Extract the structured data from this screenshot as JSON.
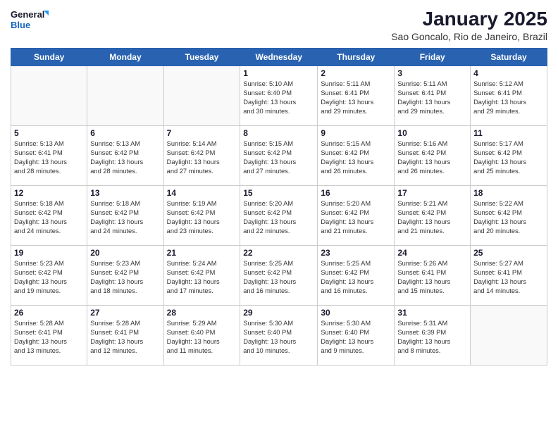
{
  "logo": {
    "line1": "General",
    "line2": "Blue"
  },
  "title": "January 2025",
  "subtitle": "Sao Goncalo, Rio de Janeiro, Brazil",
  "days_header": [
    "Sunday",
    "Monday",
    "Tuesday",
    "Wednesday",
    "Thursday",
    "Friday",
    "Saturday"
  ],
  "weeks": [
    [
      {
        "num": "",
        "info": ""
      },
      {
        "num": "",
        "info": ""
      },
      {
        "num": "",
        "info": ""
      },
      {
        "num": "1",
        "info": "Sunrise: 5:10 AM\nSunset: 6:40 PM\nDaylight: 13 hours\nand 30 minutes."
      },
      {
        "num": "2",
        "info": "Sunrise: 5:11 AM\nSunset: 6:41 PM\nDaylight: 13 hours\nand 29 minutes."
      },
      {
        "num": "3",
        "info": "Sunrise: 5:11 AM\nSunset: 6:41 PM\nDaylight: 13 hours\nand 29 minutes."
      },
      {
        "num": "4",
        "info": "Sunrise: 5:12 AM\nSunset: 6:41 PM\nDaylight: 13 hours\nand 29 minutes."
      }
    ],
    [
      {
        "num": "5",
        "info": "Sunrise: 5:13 AM\nSunset: 6:41 PM\nDaylight: 13 hours\nand 28 minutes."
      },
      {
        "num": "6",
        "info": "Sunrise: 5:13 AM\nSunset: 6:42 PM\nDaylight: 13 hours\nand 28 minutes."
      },
      {
        "num": "7",
        "info": "Sunrise: 5:14 AM\nSunset: 6:42 PM\nDaylight: 13 hours\nand 27 minutes."
      },
      {
        "num": "8",
        "info": "Sunrise: 5:15 AM\nSunset: 6:42 PM\nDaylight: 13 hours\nand 27 minutes."
      },
      {
        "num": "9",
        "info": "Sunrise: 5:15 AM\nSunset: 6:42 PM\nDaylight: 13 hours\nand 26 minutes."
      },
      {
        "num": "10",
        "info": "Sunrise: 5:16 AM\nSunset: 6:42 PM\nDaylight: 13 hours\nand 26 minutes."
      },
      {
        "num": "11",
        "info": "Sunrise: 5:17 AM\nSunset: 6:42 PM\nDaylight: 13 hours\nand 25 minutes."
      }
    ],
    [
      {
        "num": "12",
        "info": "Sunrise: 5:18 AM\nSunset: 6:42 PM\nDaylight: 13 hours\nand 24 minutes."
      },
      {
        "num": "13",
        "info": "Sunrise: 5:18 AM\nSunset: 6:42 PM\nDaylight: 13 hours\nand 24 minutes."
      },
      {
        "num": "14",
        "info": "Sunrise: 5:19 AM\nSunset: 6:42 PM\nDaylight: 13 hours\nand 23 minutes."
      },
      {
        "num": "15",
        "info": "Sunrise: 5:20 AM\nSunset: 6:42 PM\nDaylight: 13 hours\nand 22 minutes."
      },
      {
        "num": "16",
        "info": "Sunrise: 5:20 AM\nSunset: 6:42 PM\nDaylight: 13 hours\nand 21 minutes."
      },
      {
        "num": "17",
        "info": "Sunrise: 5:21 AM\nSunset: 6:42 PM\nDaylight: 13 hours\nand 21 minutes."
      },
      {
        "num": "18",
        "info": "Sunrise: 5:22 AM\nSunset: 6:42 PM\nDaylight: 13 hours\nand 20 minutes."
      }
    ],
    [
      {
        "num": "19",
        "info": "Sunrise: 5:23 AM\nSunset: 6:42 PM\nDaylight: 13 hours\nand 19 minutes."
      },
      {
        "num": "20",
        "info": "Sunrise: 5:23 AM\nSunset: 6:42 PM\nDaylight: 13 hours\nand 18 minutes."
      },
      {
        "num": "21",
        "info": "Sunrise: 5:24 AM\nSunset: 6:42 PM\nDaylight: 13 hours\nand 17 minutes."
      },
      {
        "num": "22",
        "info": "Sunrise: 5:25 AM\nSunset: 6:42 PM\nDaylight: 13 hours\nand 16 minutes."
      },
      {
        "num": "23",
        "info": "Sunrise: 5:25 AM\nSunset: 6:42 PM\nDaylight: 13 hours\nand 16 minutes."
      },
      {
        "num": "24",
        "info": "Sunrise: 5:26 AM\nSunset: 6:41 PM\nDaylight: 13 hours\nand 15 minutes."
      },
      {
        "num": "25",
        "info": "Sunrise: 5:27 AM\nSunset: 6:41 PM\nDaylight: 13 hours\nand 14 minutes."
      }
    ],
    [
      {
        "num": "26",
        "info": "Sunrise: 5:28 AM\nSunset: 6:41 PM\nDaylight: 13 hours\nand 13 minutes."
      },
      {
        "num": "27",
        "info": "Sunrise: 5:28 AM\nSunset: 6:41 PM\nDaylight: 13 hours\nand 12 minutes."
      },
      {
        "num": "28",
        "info": "Sunrise: 5:29 AM\nSunset: 6:40 PM\nDaylight: 13 hours\nand 11 minutes."
      },
      {
        "num": "29",
        "info": "Sunrise: 5:30 AM\nSunset: 6:40 PM\nDaylight: 13 hours\nand 10 minutes."
      },
      {
        "num": "30",
        "info": "Sunrise: 5:30 AM\nSunset: 6:40 PM\nDaylight: 13 hours\nand 9 minutes."
      },
      {
        "num": "31",
        "info": "Sunrise: 5:31 AM\nSunset: 6:39 PM\nDaylight: 13 hours\nand 8 minutes."
      },
      {
        "num": "",
        "info": ""
      }
    ]
  ]
}
